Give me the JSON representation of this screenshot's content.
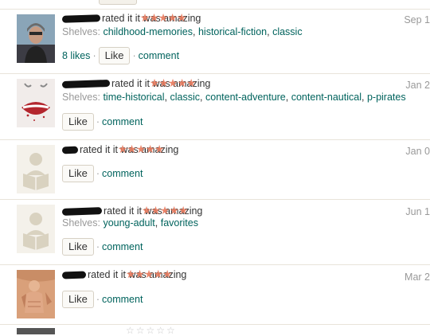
{
  "reviews": [
    {
      "avatar": "woman-photo",
      "rated_text": "rated it",
      "rating_words": "it was amazing",
      "stars": "★★★★★",
      "shelves_label": "Shelves:",
      "shelves": [
        "childhood-memories",
        "historical-fiction",
        "classic"
      ],
      "likes": "8 likes",
      "like_label": "Like",
      "comment_label": "comment",
      "date": "Sep 1"
    },
    {
      "avatar": "lips-art",
      "rated_text": "rated it",
      "rating_words": "it was amazing",
      "stars": "★★★★★",
      "shelves_label": "Shelves:",
      "shelves": [
        "time-historical",
        "classic",
        "content-adventure",
        "content-nautical",
        "p-pirates"
      ],
      "likes": "",
      "like_label": "Like",
      "comment_label": "comment",
      "date": "Jan 2"
    },
    {
      "avatar": "default-reader-silhouette",
      "rated_text": "rated it",
      "rating_words": "it was amazing",
      "stars": "★★★★★",
      "shelves_label": "",
      "shelves": [],
      "likes": "",
      "like_label": "Like",
      "comment_label": "comment",
      "date": "Jan 0"
    },
    {
      "avatar": "default-reader-silhouette",
      "rated_text": "rated it",
      "rating_words": "it was amazing",
      "stars": "★★★★★",
      "shelves_label": "Shelves:",
      "shelves": [
        "young-adult",
        "favorites"
      ],
      "likes": "",
      "like_label": "Like",
      "comment_label": "comment",
      "date": "Jun 1"
    },
    {
      "avatar": "carved-relief",
      "rated_text": "rated it",
      "rating_words": "it was amazing",
      "stars": "★★★★★",
      "shelves_label": "",
      "shelves": [],
      "likes": "",
      "like_label": "Like",
      "comment_label": "comment",
      "date": "Mar 2"
    }
  ],
  "colors": {
    "link": "#00635d",
    "muted": "#999999",
    "star": "#e87a5d",
    "divider": "#e8e4da",
    "button_bg": "#fbfaf7"
  }
}
